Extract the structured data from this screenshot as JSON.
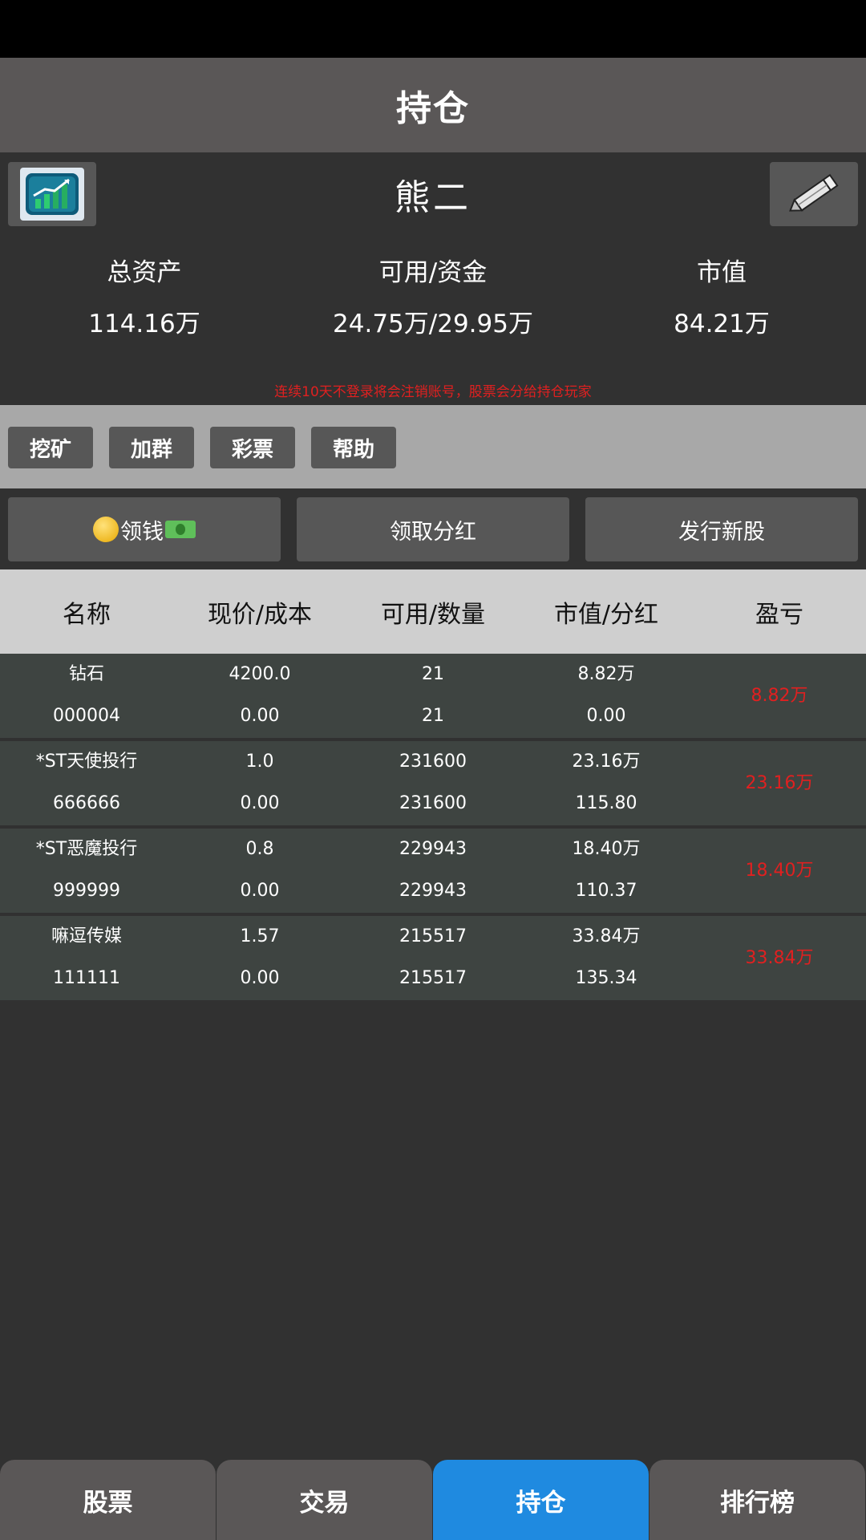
{
  "header": {
    "title": "持仓"
  },
  "profile": {
    "username": "熊二",
    "avatar_icon": "chart-app-icon",
    "edit_icon": "pencil-icon"
  },
  "stats": [
    {
      "label": "总资产",
      "value": "114.16万"
    },
    {
      "label": "可用/资金",
      "value": "24.75万/29.95万"
    },
    {
      "label": "市值",
      "value": "84.21万"
    }
  ],
  "notice": "连续10天不登录将会注销账号，股票会分给持仓玩家",
  "actions": [
    "挖矿",
    "加群",
    "彩票",
    "帮助"
  ],
  "buttons": {
    "collect_money": "领钱",
    "collect_dividend": "领取分红",
    "issue_stock": "发行新股"
  },
  "table": {
    "headers": [
      "名称",
      "现价/成本",
      "可用/数量",
      "市值/分红",
      "盈亏"
    ],
    "rows": [
      {
        "name": "钻石",
        "code": "000004",
        "price": "4200.0",
        "cost": "0.00",
        "available": "21",
        "quantity": "21",
        "market_value": "8.82万",
        "dividend": "0.00",
        "pnl": "8.82万"
      },
      {
        "name": "*ST天使投行",
        "code": "666666",
        "price": "1.0",
        "cost": "0.00",
        "available": "231600",
        "quantity": "231600",
        "market_value": "23.16万",
        "dividend": "115.80",
        "pnl": "23.16万"
      },
      {
        "name": "*ST恶魔投行",
        "code": "999999",
        "price": "0.8",
        "cost": "0.00",
        "available": "229943",
        "quantity": "229943",
        "market_value": "18.40万",
        "dividend": "110.37",
        "pnl": "18.40万"
      },
      {
        "name": "嘛逗传媒",
        "code": "111111",
        "price": "1.57",
        "cost": "0.00",
        "available": "215517",
        "quantity": "215517",
        "market_value": "33.84万",
        "dividend": "135.34",
        "pnl": "33.84万"
      }
    ]
  },
  "tabs": [
    {
      "label": "股票",
      "active": false
    },
    {
      "label": "交易",
      "active": false
    },
    {
      "label": "持仓",
      "active": true
    },
    {
      "label": "排行榜",
      "active": false
    }
  ],
  "colors": {
    "accent": "#1f8ae0",
    "loss_profit": "#e02020",
    "panel": "#575757"
  }
}
